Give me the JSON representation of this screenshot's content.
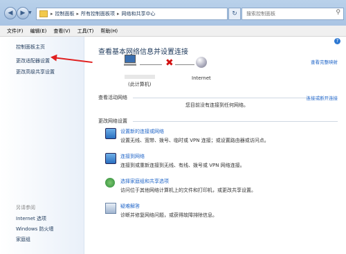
{
  "address_bar": {
    "crumbs": [
      "控制面板",
      "所有控制面板项",
      "网络和共享中心"
    ]
  },
  "search": {
    "placeholder": "搜索控制面板"
  },
  "menu": [
    "文件(F)",
    "编辑(E)",
    "查看(V)",
    "工具(T)",
    "帮助(H)"
  ],
  "sidebar": {
    "top_links": [
      "控制面板主页",
      "更改适配器设置",
      "更改高级共享设置"
    ],
    "see_also_heading": "另请参阅",
    "see_also_links": [
      "Internet 选项",
      "Windows 防火墙",
      "家庭组"
    ]
  },
  "main": {
    "title": "查看基本网络信息并设置连接",
    "full_map_link": "查看完整映射",
    "pc_label": "(此计算机)",
    "internet_label": "Internet",
    "active_section": "查看活动网络",
    "connect_or_disconnect": "连接或断开连接",
    "not_connected": "您目前没有连接到任何网络。",
    "change_section": "更改网络设置",
    "tasks": [
      {
        "title": "设置新的连接或网络",
        "desc": "设置无线、宽带、拨号、临时或 VPN 连接；或设置路由器或访问点。",
        "icon": "network-setup-icon"
      },
      {
        "title": "连接到网络",
        "desc": "连接到或重新连接到无线、有线、拨号或 VPN 网络连接。",
        "icon": "connect-network-icon"
      },
      {
        "title": "选择家庭组和共享选项",
        "desc": "访问位于其他网络计算机上的文件和打印机，或更改共享设置。",
        "icon": "homegroup-icon"
      },
      {
        "title": "疑难解答",
        "desc": "诊断并修复网络问题，或获得故障排除信息。",
        "icon": "troubleshoot-icon"
      }
    ]
  },
  "colors": {
    "link": "#1e64c8",
    "annotation_arrow": "#e02020",
    "disconnect_x": "#d21010"
  }
}
